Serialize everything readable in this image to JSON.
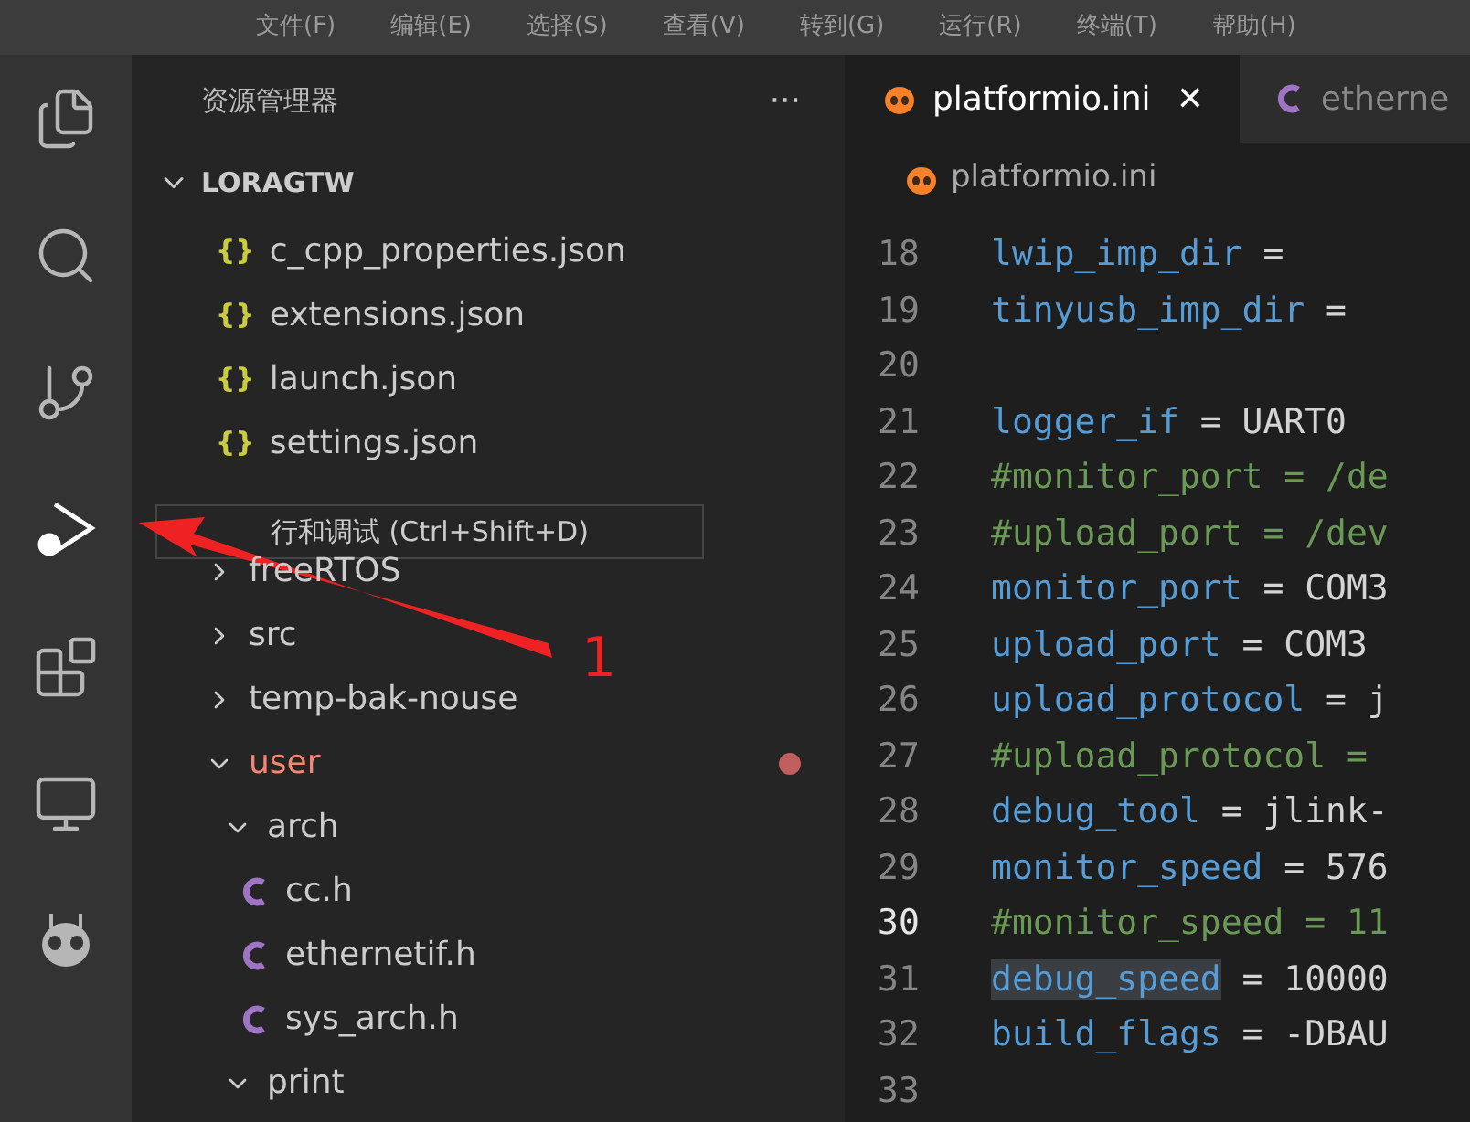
{
  "menu_bar": [
    "文件(F)",
    "编辑(E)",
    "选择(S)",
    "查看(V)",
    "转到(G)",
    "运行(R)",
    "终端(T)",
    "帮助(H)"
  ],
  "activity_bar": [
    {
      "kind": "files",
      "selected": false
    },
    {
      "kind": "search",
      "selected": false
    },
    {
      "kind": "source-control",
      "selected": false
    },
    {
      "kind": "run-debug",
      "selected": true
    },
    {
      "kind": "extensions",
      "selected": false
    },
    {
      "kind": "remote",
      "selected": false
    },
    {
      "kind": "platformio",
      "selected": false
    }
  ],
  "sidebar": {
    "title": "资源管理器",
    "more": "···",
    "root": "LORAGTW"
  },
  "vscode_files": [
    {
      "icon": "{}",
      "label": "c_cpp_properties.json"
    },
    {
      "icon": "{}",
      "label": "extensions.json"
    },
    {
      "icon": "{}",
      "label": "launch.json"
    },
    {
      "icon": "{}",
      "label": "settings.json"
    }
  ],
  "tree": [
    {
      "label": "freeRTOS",
      "kind": "folder",
      "expanded": false,
      "error": false
    },
    {
      "label": "src",
      "kind": "folder",
      "expanded": false,
      "error": false
    },
    {
      "label": "temp-bak-nouse",
      "kind": "folder",
      "expanded": false,
      "error": false
    },
    {
      "label": "user",
      "kind": "folder",
      "expanded": true,
      "error": true,
      "children": [
        {
          "label": "arch",
          "kind": "folder",
          "expanded": true,
          "error": false,
          "children": [
            {
              "label": "cc.h",
              "kind": "c",
              "error": false
            },
            {
              "label": "ethernetif.h",
              "kind": "c",
              "error": false
            },
            {
              "label": "sys_arch.h",
              "kind": "c",
              "error": false
            }
          ]
        },
        {
          "label": "print",
          "kind": "folder",
          "expanded": true,
          "error": false
        }
      ]
    }
  ],
  "tabs": [
    {
      "label": "platformio.ini",
      "kind": "platformio",
      "selected": true,
      "close": "✕"
    },
    {
      "label": "etherne",
      "kind": "c",
      "selected": false
    }
  ],
  "breadcrumb": "platformio.ini",
  "lines": [
    {
      "number": "18",
      "kind": "setting",
      "key": "lwip_imp_dir",
      "value": "=",
      "current": false,
      "selected": false
    },
    {
      "number": "19",
      "kind": "setting",
      "key": "tinyusb_imp_dir",
      "value": "=",
      "current": false,
      "selected": false
    },
    {
      "number": "20",
      "kind": "blank",
      "current": false,
      "selected": false
    },
    {
      "number": "21",
      "kind": "setting",
      "key": "logger_if",
      "value": "= UART0",
      "current": false,
      "selected": false
    },
    {
      "number": "22",
      "kind": "comment",
      "text": "#monitor_port = /de",
      "current": false,
      "selected": false
    },
    {
      "number": "23",
      "kind": "comment",
      "text": "#upload_port = /dev",
      "current": false,
      "selected": false
    },
    {
      "number": "24",
      "kind": "setting",
      "key": "monitor_port",
      "value": "= COM3",
      "current": false,
      "selected": false
    },
    {
      "number": "25",
      "kind": "setting",
      "key": "upload_port",
      "value": "= COM3",
      "current": false,
      "selected": false
    },
    {
      "number": "26",
      "kind": "setting",
      "key": "upload_protocol",
      "value": "= j",
      "current": false,
      "selected": false
    },
    {
      "number": "27",
      "kind": "comment",
      "text": "#upload_protocol =",
      "current": false,
      "selected": false
    },
    {
      "number": "28",
      "kind": "setting",
      "key": "debug_tool",
      "value": "= jlink-",
      "current": false,
      "selected": false
    },
    {
      "number": "29",
      "kind": "setting",
      "key": "monitor_speed",
      "value": "= 576",
      "current": false,
      "selected": false
    },
    {
      "number": "30",
      "kind": "comment",
      "text": "#monitor_speed = 11",
      "current": true,
      "selected": false
    },
    {
      "number": "31",
      "kind": "setting",
      "key": "debug_speed",
      "value": "= 10000",
      "current": false,
      "selected": true
    },
    {
      "number": "32",
      "kind": "setting",
      "key": "build_flags",
      "value": "= -DBAU",
      "current": false,
      "selected": false
    },
    {
      "number": "33",
      "kind": "blank",
      "current": false,
      "selected": false
    }
  ],
  "tooltip": "行和调试 (Ctrl+Shift+D)",
  "annotation": "1"
}
